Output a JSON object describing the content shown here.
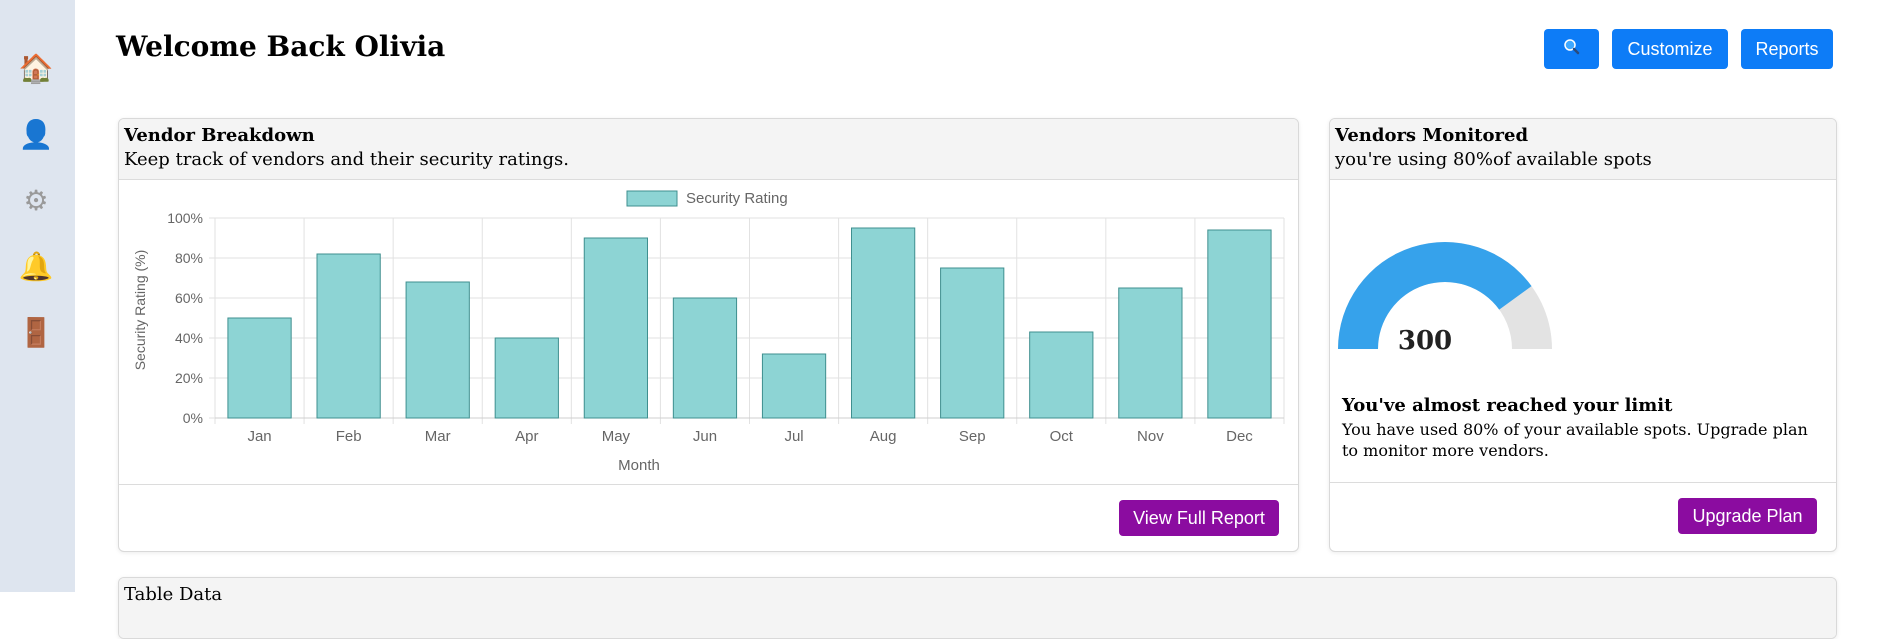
{
  "header": {
    "title": "Welcome Back Olivia",
    "search_icon": "search-icon",
    "customize_label": "Customize",
    "reports_label": "Reports"
  },
  "sidebar": {
    "items": [
      {
        "icon": "home-icon",
        "glyph": "🏠"
      },
      {
        "icon": "user-icon",
        "glyph": "👤"
      },
      {
        "icon": "gear-icon",
        "glyph": "⚙"
      },
      {
        "icon": "bell-icon",
        "glyph": "🔔"
      },
      {
        "icon": "door-icon",
        "glyph": "🚪"
      }
    ]
  },
  "vendor_breakdown": {
    "title": "Vendor Breakdown",
    "subtitle": "Keep track of vendors and their security ratings.",
    "button_label": "View Full Report"
  },
  "vendors_monitored": {
    "title": "Vendors Monitored",
    "subtitle": "you're using 80%of available spots",
    "gauge_value": "300",
    "gauge_fraction": 0.8,
    "limit_title": "You've almost reached your limit",
    "limit_text": "You have used 80% of your available spots. Upgrade plan to monitor more vendors.",
    "button_label": "Upgrade Plan"
  },
  "table_card": {
    "title": "Table Data"
  },
  "colors": {
    "accent_blue": "#0d7cf7",
    "purple": "#8b0ca0",
    "bar_fill": "#8dd4d4",
    "bar_stroke": "#3f8f8f",
    "gauge_fill": "#36a2eb",
    "gauge_track": "#e3e3e3"
  },
  "chart_data": {
    "type": "bar",
    "categories": [
      "Jan",
      "Feb",
      "Mar",
      "Apr",
      "May",
      "Jun",
      "Jul",
      "Aug",
      "Sep",
      "Oct",
      "Nov",
      "Dec"
    ],
    "series": [
      {
        "name": "Security Rating",
        "values": [
          50,
          82,
          68,
          40,
          90,
          60,
          32,
          95,
          75,
          43,
          65,
          94
        ]
      }
    ],
    "xlabel": "Month",
    "ylabel": "Security Rating (%)",
    "ylim": [
      0,
      100
    ],
    "yticks": [
      "0%",
      "20%",
      "40%",
      "60%",
      "80%",
      "100%"
    ],
    "ytick_values": [
      0,
      20,
      40,
      60,
      80,
      100
    ],
    "grid": true,
    "legend": "top"
  }
}
